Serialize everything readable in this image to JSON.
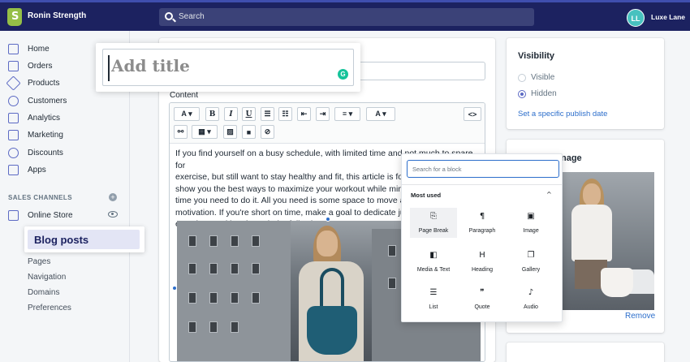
{
  "topbar": {
    "logo_glyph": "S",
    "store_name": "Ronin Strength",
    "search_placeholder": "Search",
    "avatar_initials": "LL",
    "user_name": "Luxe Lane"
  },
  "sidebar": {
    "items": [
      {
        "label": "Home",
        "icon": "home-icon"
      },
      {
        "label": "Orders",
        "icon": "orders-icon"
      },
      {
        "label": "Products",
        "icon": "tag-icon"
      },
      {
        "label": "Customers",
        "icon": "person-icon"
      },
      {
        "label": "Analytics",
        "icon": "chart-icon"
      },
      {
        "label": "Marketing",
        "icon": "megaphone-icon"
      },
      {
        "label": "Discounts",
        "icon": "discount-icon"
      },
      {
        "label": "Apps",
        "icon": "apps-icon"
      }
    ],
    "sales_channels_title": "SALES CHANNELS",
    "online_store": "Online Store",
    "blog_posts": "Blog posts",
    "sub_items": [
      "Pages",
      "Navigation",
      "Domains",
      "Preferences"
    ]
  },
  "editor": {
    "title_placeholder": "Add title",
    "content_label": "Content",
    "toolbar": {
      "font_btn": "A ▾",
      "bold": "B",
      "italic": "I",
      "underline": "U",
      "code": "<>",
      "color_btn": "A ▾"
    },
    "body_text": "If you find yourself on a busy schedule, with limited time and not much to spare for\nexercise, but still want to stay healthy and fit, this article is for\nshow you the best ways to maximize your workout while minin\ntime you need to do it. All you need is some space to move ar\nmotivation. If you're short on time, make a goal to dedicate jus\nexercise, working through the following movements."
  },
  "visibility": {
    "title": "Visibility",
    "options": [
      {
        "label": "Visible",
        "selected": false
      },
      {
        "label": "Hidden",
        "selected": true
      }
    ],
    "publish_link": "Set a specific publish date"
  },
  "featured_image": {
    "title": "nage",
    "remove_link": "Remove"
  },
  "inserter": {
    "search_placeholder": "Search for a block",
    "section_title": "Most used",
    "chevron": "^",
    "blocks": [
      {
        "label": "Page Break",
        "glyph": "⎘",
        "icon": "page-break-icon"
      },
      {
        "label": "Paragraph",
        "glyph": "¶",
        "icon": "paragraph-icon"
      },
      {
        "label": "Image",
        "glyph": "▣",
        "icon": "image-icon"
      },
      {
        "label": "Media & Text",
        "glyph": "◧",
        "icon": "media-text-icon"
      },
      {
        "label": "Heading",
        "glyph": "H",
        "icon": "heading-icon"
      },
      {
        "label": "Gallery",
        "glyph": "❐",
        "icon": "gallery-icon"
      },
      {
        "label": "List",
        "glyph": "☰",
        "icon": "list-icon"
      },
      {
        "label": "Quote",
        "glyph": "❞",
        "icon": "quote-icon"
      },
      {
        "label": "Audio",
        "glyph": "♪",
        "icon": "audio-icon"
      }
    ]
  },
  "colors": {
    "topbar": "#1c2260",
    "accent": "#5c6ac4",
    "link": "#2c6ecb",
    "shopify_green": "#95bf47"
  }
}
